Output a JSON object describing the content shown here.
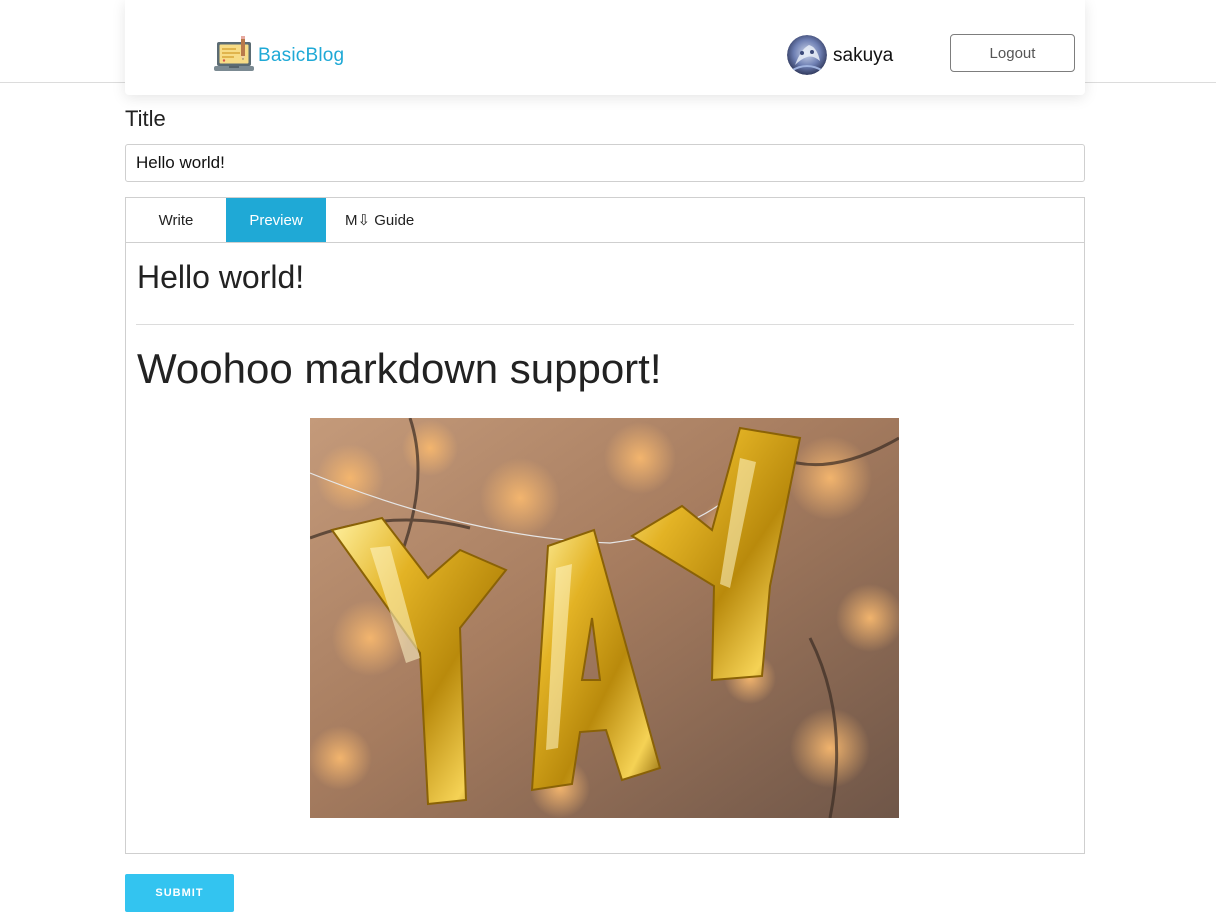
{
  "header": {
    "brand_name": "BasicBlog",
    "brand_icon": "laptop-pencil-icon",
    "username": "sakuya",
    "logout_label": "Logout"
  },
  "form": {
    "title_label": "Title",
    "title_value": "Hello world!",
    "tabs": [
      {
        "label": "Write",
        "active": false
      },
      {
        "label": "Preview",
        "active": true
      },
      {
        "label": "M⇩ Guide",
        "active": false
      }
    ],
    "submit_label": "SUBMIT"
  },
  "preview": {
    "heading1": "Hello world!",
    "heading2": "Woohoo markdown support!",
    "image_alt": "YAY gold foil balloons"
  },
  "colors": {
    "accent": "#1fa9d6",
    "submit": "#33c4f0"
  }
}
